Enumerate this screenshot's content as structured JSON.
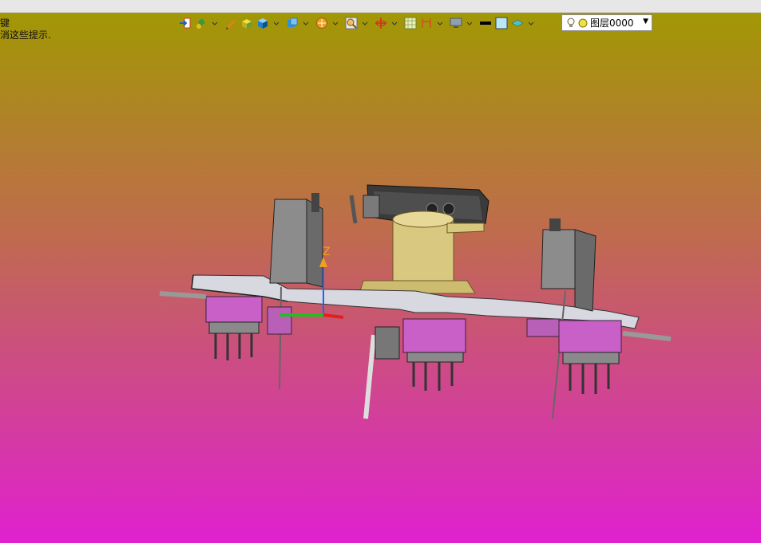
{
  "hints": {
    "line1": "键",
    "line2": "消这些提示."
  },
  "toolbar": {
    "items": [
      {
        "icon": "exit-view-icon",
        "dropdown": false
      },
      {
        "icon": "paint-bucket-icon",
        "dropdown": true
      },
      {
        "icon": "pencil-icon",
        "dropdown": false
      },
      {
        "icon": "box-yellow-icon",
        "dropdown": false
      },
      {
        "icon": "cube-blue-icon",
        "dropdown": true
      },
      {
        "icon": "view-cube-icon",
        "dropdown": true
      },
      {
        "icon": "sphere-section-icon",
        "dropdown": true
      },
      {
        "icon": "zoom-fit-icon",
        "dropdown": true
      },
      {
        "icon": "rotate-axis-icon",
        "dropdown": true
      },
      {
        "icon": "grid-icon",
        "dropdown": false
      },
      {
        "icon": "dimension-icon",
        "dropdown": true
      },
      {
        "icon": "monitor-icon",
        "dropdown": true
      },
      {
        "icon": "line-black-icon",
        "dropdown": false
      },
      {
        "icon": "color-swatch-icon",
        "dropdown": false
      },
      {
        "icon": "layer-stack-icon",
        "dropdown": true
      }
    ]
  },
  "layer_select": {
    "value": "图层0000"
  },
  "axis_label": "Z"
}
